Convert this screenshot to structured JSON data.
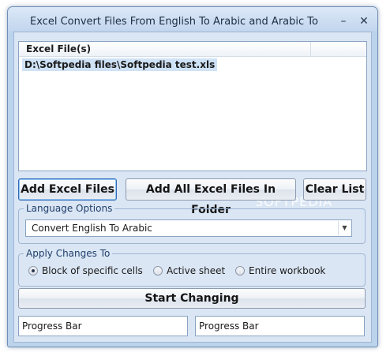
{
  "window": {
    "title": "Excel Convert Files From English To Arabic and Arabic To En...",
    "minimize_glyph": "–",
    "close_glyph": "✕"
  },
  "file_list": {
    "header": "Excel File(s)",
    "items": [
      "D:\\Softpedia files\\Softpedia test.xls"
    ]
  },
  "buttons": {
    "add_excel_files": "Add Excel Files",
    "add_all_excel_files": "Add All Excel Files In Folder",
    "clear_list": "Clear List",
    "start_changing": "Start Changing"
  },
  "language_options": {
    "title": "Language Options",
    "selected": "Convert English To Arabic"
  },
  "apply_changes": {
    "title": "Apply Changes To",
    "options": [
      "Block of specific cells",
      "Active sheet",
      "Entire workbook"
    ],
    "selected_index": 0
  },
  "progress": {
    "left_label": "Progress Bar",
    "right_label": "Progress Bar"
  },
  "watermark": "SOFTPEDIA",
  "colors": {
    "window_frame": "#bcd3ec",
    "client_bg": "#dbe6f4",
    "group_title": "#1f3f6b",
    "selection": "#cfe2f6"
  }
}
